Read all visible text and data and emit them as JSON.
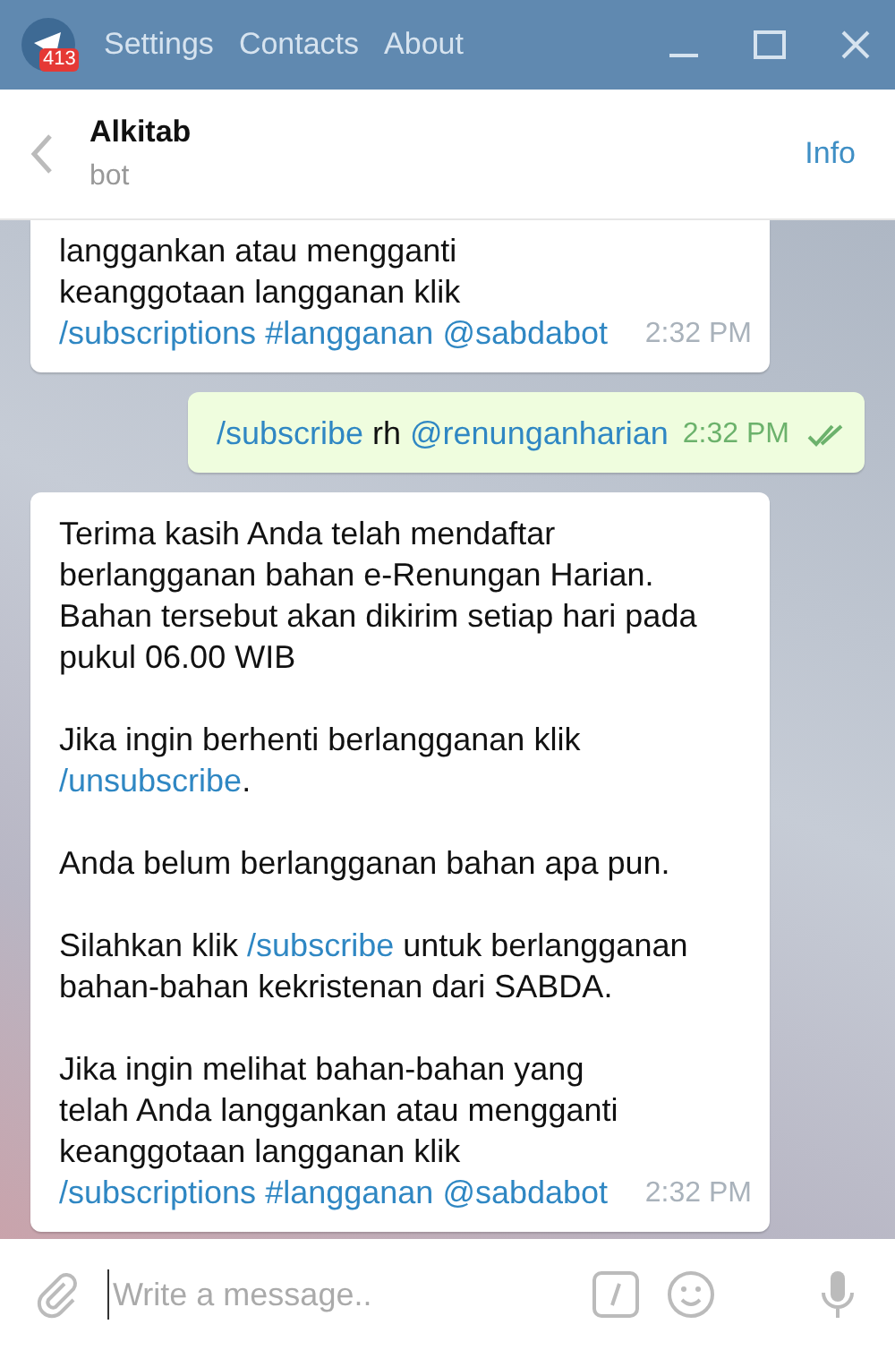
{
  "titlebar": {
    "badge": "413",
    "menu": [
      "Settings",
      "Contacts",
      "About"
    ]
  },
  "chat": {
    "name": "Alkitab",
    "status": "bot",
    "info": "Info"
  },
  "messages": [
    {
      "kind": "incoming",
      "time": "2:32 PM",
      "paragraphs": [
        [
          {
            "kind": "text",
            "text": "langgankan atau mengganti keanggotaan langganan klik "
          },
          {
            "kind": "link",
            "text": "/subscriptions"
          },
          {
            "kind": "link",
            "text": "#langganan"
          },
          {
            "kind": "link",
            "text": "@sabdabot"
          }
        ]
      ]
    },
    {
      "kind": "outgoing",
      "time": "2:32 PM",
      "read": true,
      "paragraphs": [
        [
          {
            "kind": "link",
            "text": "/subscribe"
          },
          {
            "kind": "text",
            "text": " rh "
          },
          {
            "kind": "link",
            "text": "@renunganharian"
          }
        ]
      ]
    },
    {
      "kind": "incoming",
      "time": "2:32 PM",
      "paragraphs": [
        [
          {
            "kind": "text",
            "text": "Terima kasih Anda telah mendaftar berlangganan bahan e-Renungan Harian. Bahan tersebut akan dikirim setiap hari pada pukul 06.00 WIB"
          }
        ],
        [
          {
            "kind": "text",
            "text": "Jika ingin berhenti berlangganan klik "
          },
          {
            "kind": "link",
            "text": "/unsubscribe"
          },
          {
            "kind": "text",
            "text": "."
          }
        ],
        [
          {
            "kind": "text",
            "text": "Anda belum berlangganan bahan apa pun."
          }
        ],
        [
          {
            "kind": "text",
            "text": "Silahkan klik "
          },
          {
            "kind": "link",
            "text": "/subscribe"
          },
          {
            "kind": "text",
            "text": " untuk berlangganan bahan-bahan kekristenan dari SABDA."
          }
        ],
        [
          {
            "kind": "text",
            "text": "Jika ingin melihat bahan-bahan yang telah Anda langgankan atau mengganti keanggotaan langganan klik "
          },
          {
            "kind": "link",
            "text": "/subscriptions"
          },
          {
            "kind": "link",
            "text": "#langganan"
          },
          {
            "kind": "link",
            "text": "@sabdabot"
          }
        ]
      ]
    }
  ],
  "composer": {
    "placeholder": "Write a message.."
  }
}
